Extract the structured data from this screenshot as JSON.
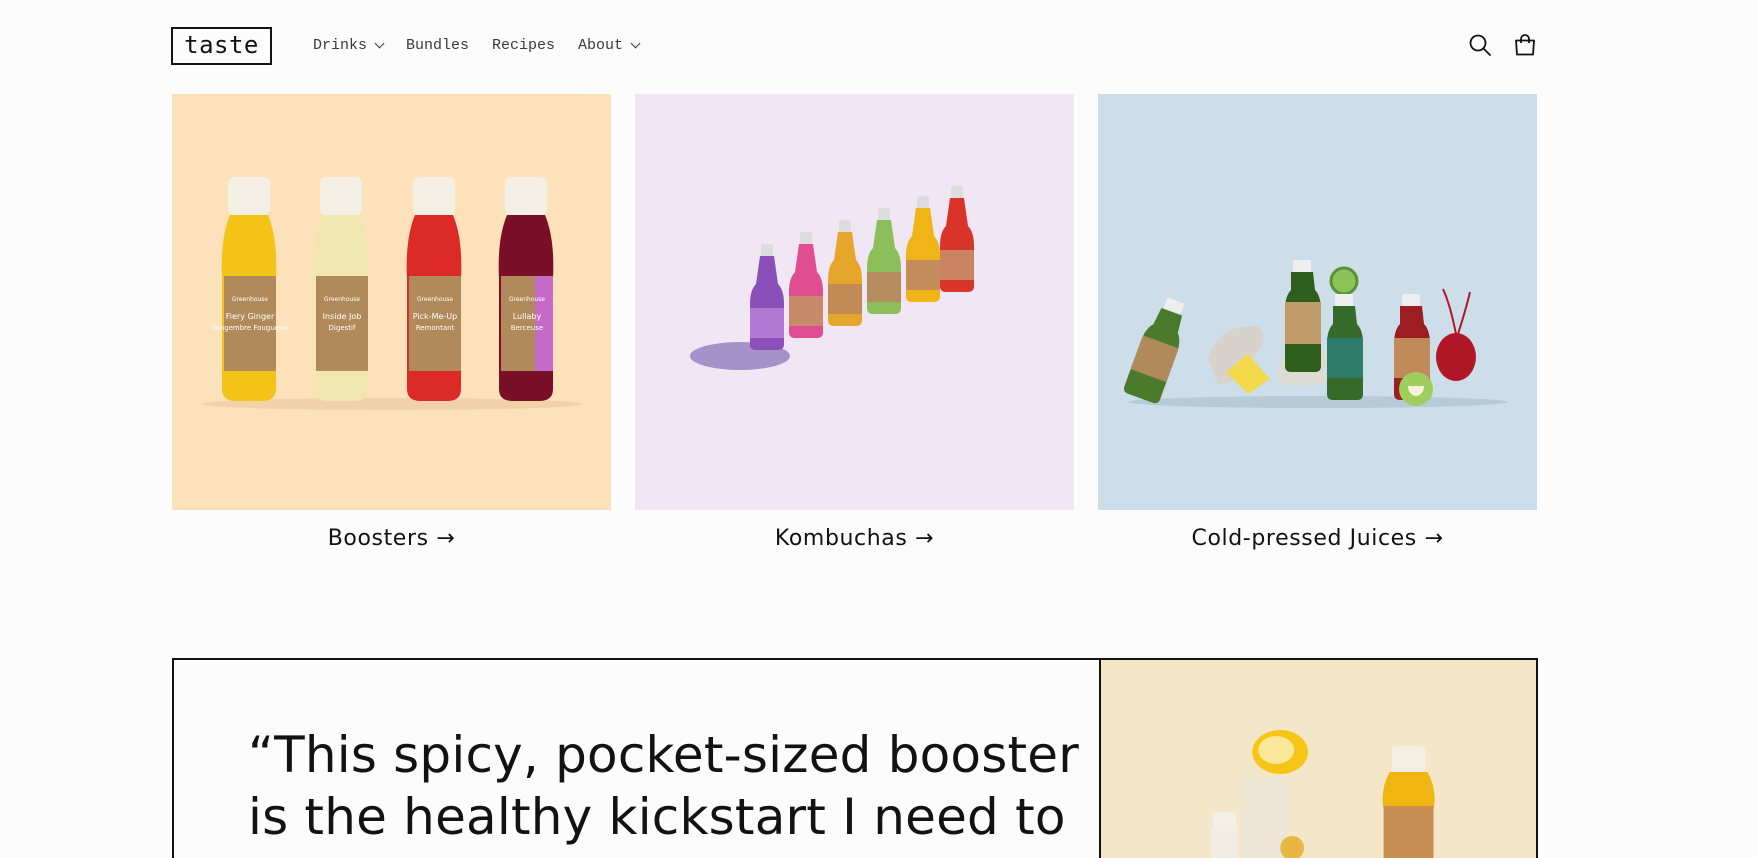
{
  "header": {
    "logo": "taste",
    "nav": [
      {
        "label": "Drinks",
        "has_dropdown": true
      },
      {
        "label": "Bundles",
        "has_dropdown": false
      },
      {
        "label": "Recipes",
        "has_dropdown": false
      },
      {
        "label": "About",
        "has_dropdown": true
      }
    ],
    "icons": [
      "search-icon",
      "cart-icon"
    ]
  },
  "collections": [
    {
      "label": "Boosters →",
      "background": "#fde1ba",
      "bottles": [
        {
          "name": "Fiery Ginger",
          "subtitle": "Gingembre Fougueux",
          "color": "#f2c417"
        },
        {
          "name": "Inside Job",
          "subtitle": "Digestif",
          "color": "#efe6b0"
        },
        {
          "name": "Pick-Me-Up",
          "subtitle": "Remontant",
          "color": "#dc2a26"
        },
        {
          "name": "Lullaby",
          "subtitle": "Berceuse",
          "color": "#7a1028"
        }
      ],
      "brand": "Greenhouse"
    },
    {
      "label": "Kombuchas →",
      "background": "#f0e6f4"
    },
    {
      "label": "Cold-pressed Juices →",
      "background": "#cddeea"
    }
  ],
  "testimonial": {
    "line1": "“This spicy, pocket-sized booster",
    "line2": "is the healthy kickstart I need to",
    "image_background": "#f4e6c8"
  }
}
